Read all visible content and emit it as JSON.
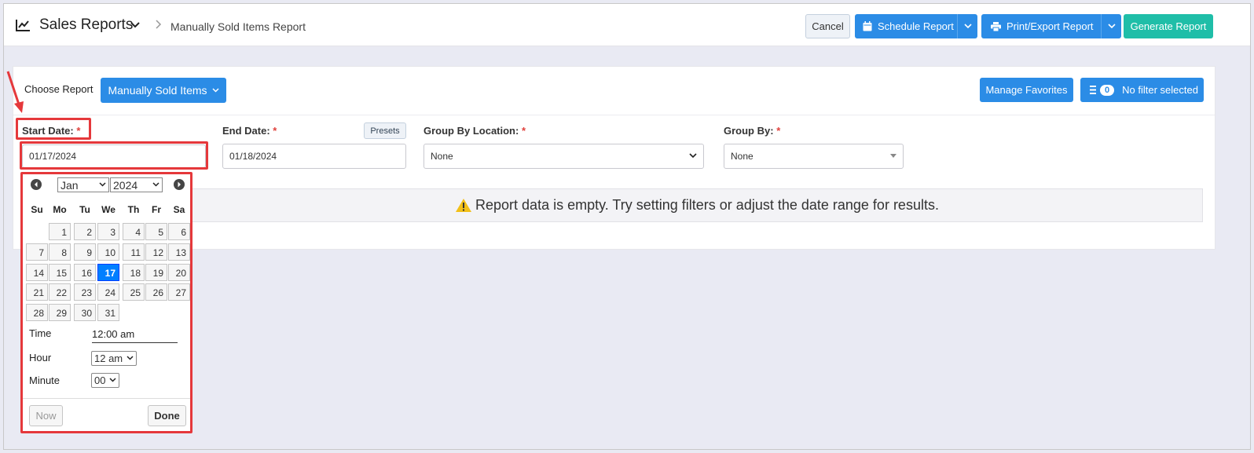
{
  "header": {
    "title": "Sales Reports",
    "breadcrumb": "Manually Sold Items Report",
    "cancel_label": "Cancel",
    "schedule_label": "Schedule Report",
    "print_label": "Print/Export Report",
    "generate_label": "Generate Report"
  },
  "filters": {
    "choose_label": "Choose Report",
    "report_selected": "Manually Sold Items",
    "favorites_label": "Manage Favorites",
    "filter_count": "0",
    "filter_label": "No filter selected",
    "start_label": "Start Date:",
    "start_value": "01/17/2024",
    "end_label": "End Date:",
    "end_value": "01/18/2024",
    "presets_label": "Presets",
    "group_location_label": "Group By Location:",
    "group_location_value": "None",
    "group_by_label": "Group By:",
    "group_by_value": "None",
    "required_mark": "*"
  },
  "empty_message": "Report data is empty. Try setting filters or adjust the date range for results.",
  "datepicker": {
    "month": "Jan",
    "year": "2024",
    "dow": [
      "Su",
      "Mo",
      "Tu",
      "We",
      "Th",
      "Fr",
      "Sa"
    ],
    "days": [
      "1",
      "2",
      "3",
      "4",
      "5",
      "6",
      "7",
      "8",
      "9",
      "10",
      "11",
      "12",
      "13",
      "14",
      "15",
      "16",
      "17",
      "18",
      "19",
      "20",
      "21",
      "22",
      "23",
      "24",
      "25",
      "26",
      "27",
      "28",
      "29",
      "30",
      "31"
    ],
    "selected_day": "17",
    "time_label": "Time",
    "time_value": "12:00 am",
    "hour_label": "Hour",
    "hour_value": "12 am",
    "minute_label": "Minute",
    "minute_value": "00",
    "now_label": "Now",
    "done_label": "Done"
  },
  "colors": {
    "primary": "#2b8ce6",
    "generate": "#1fbea8",
    "highlight": "#e5383b",
    "selected_day": "#007fff"
  }
}
